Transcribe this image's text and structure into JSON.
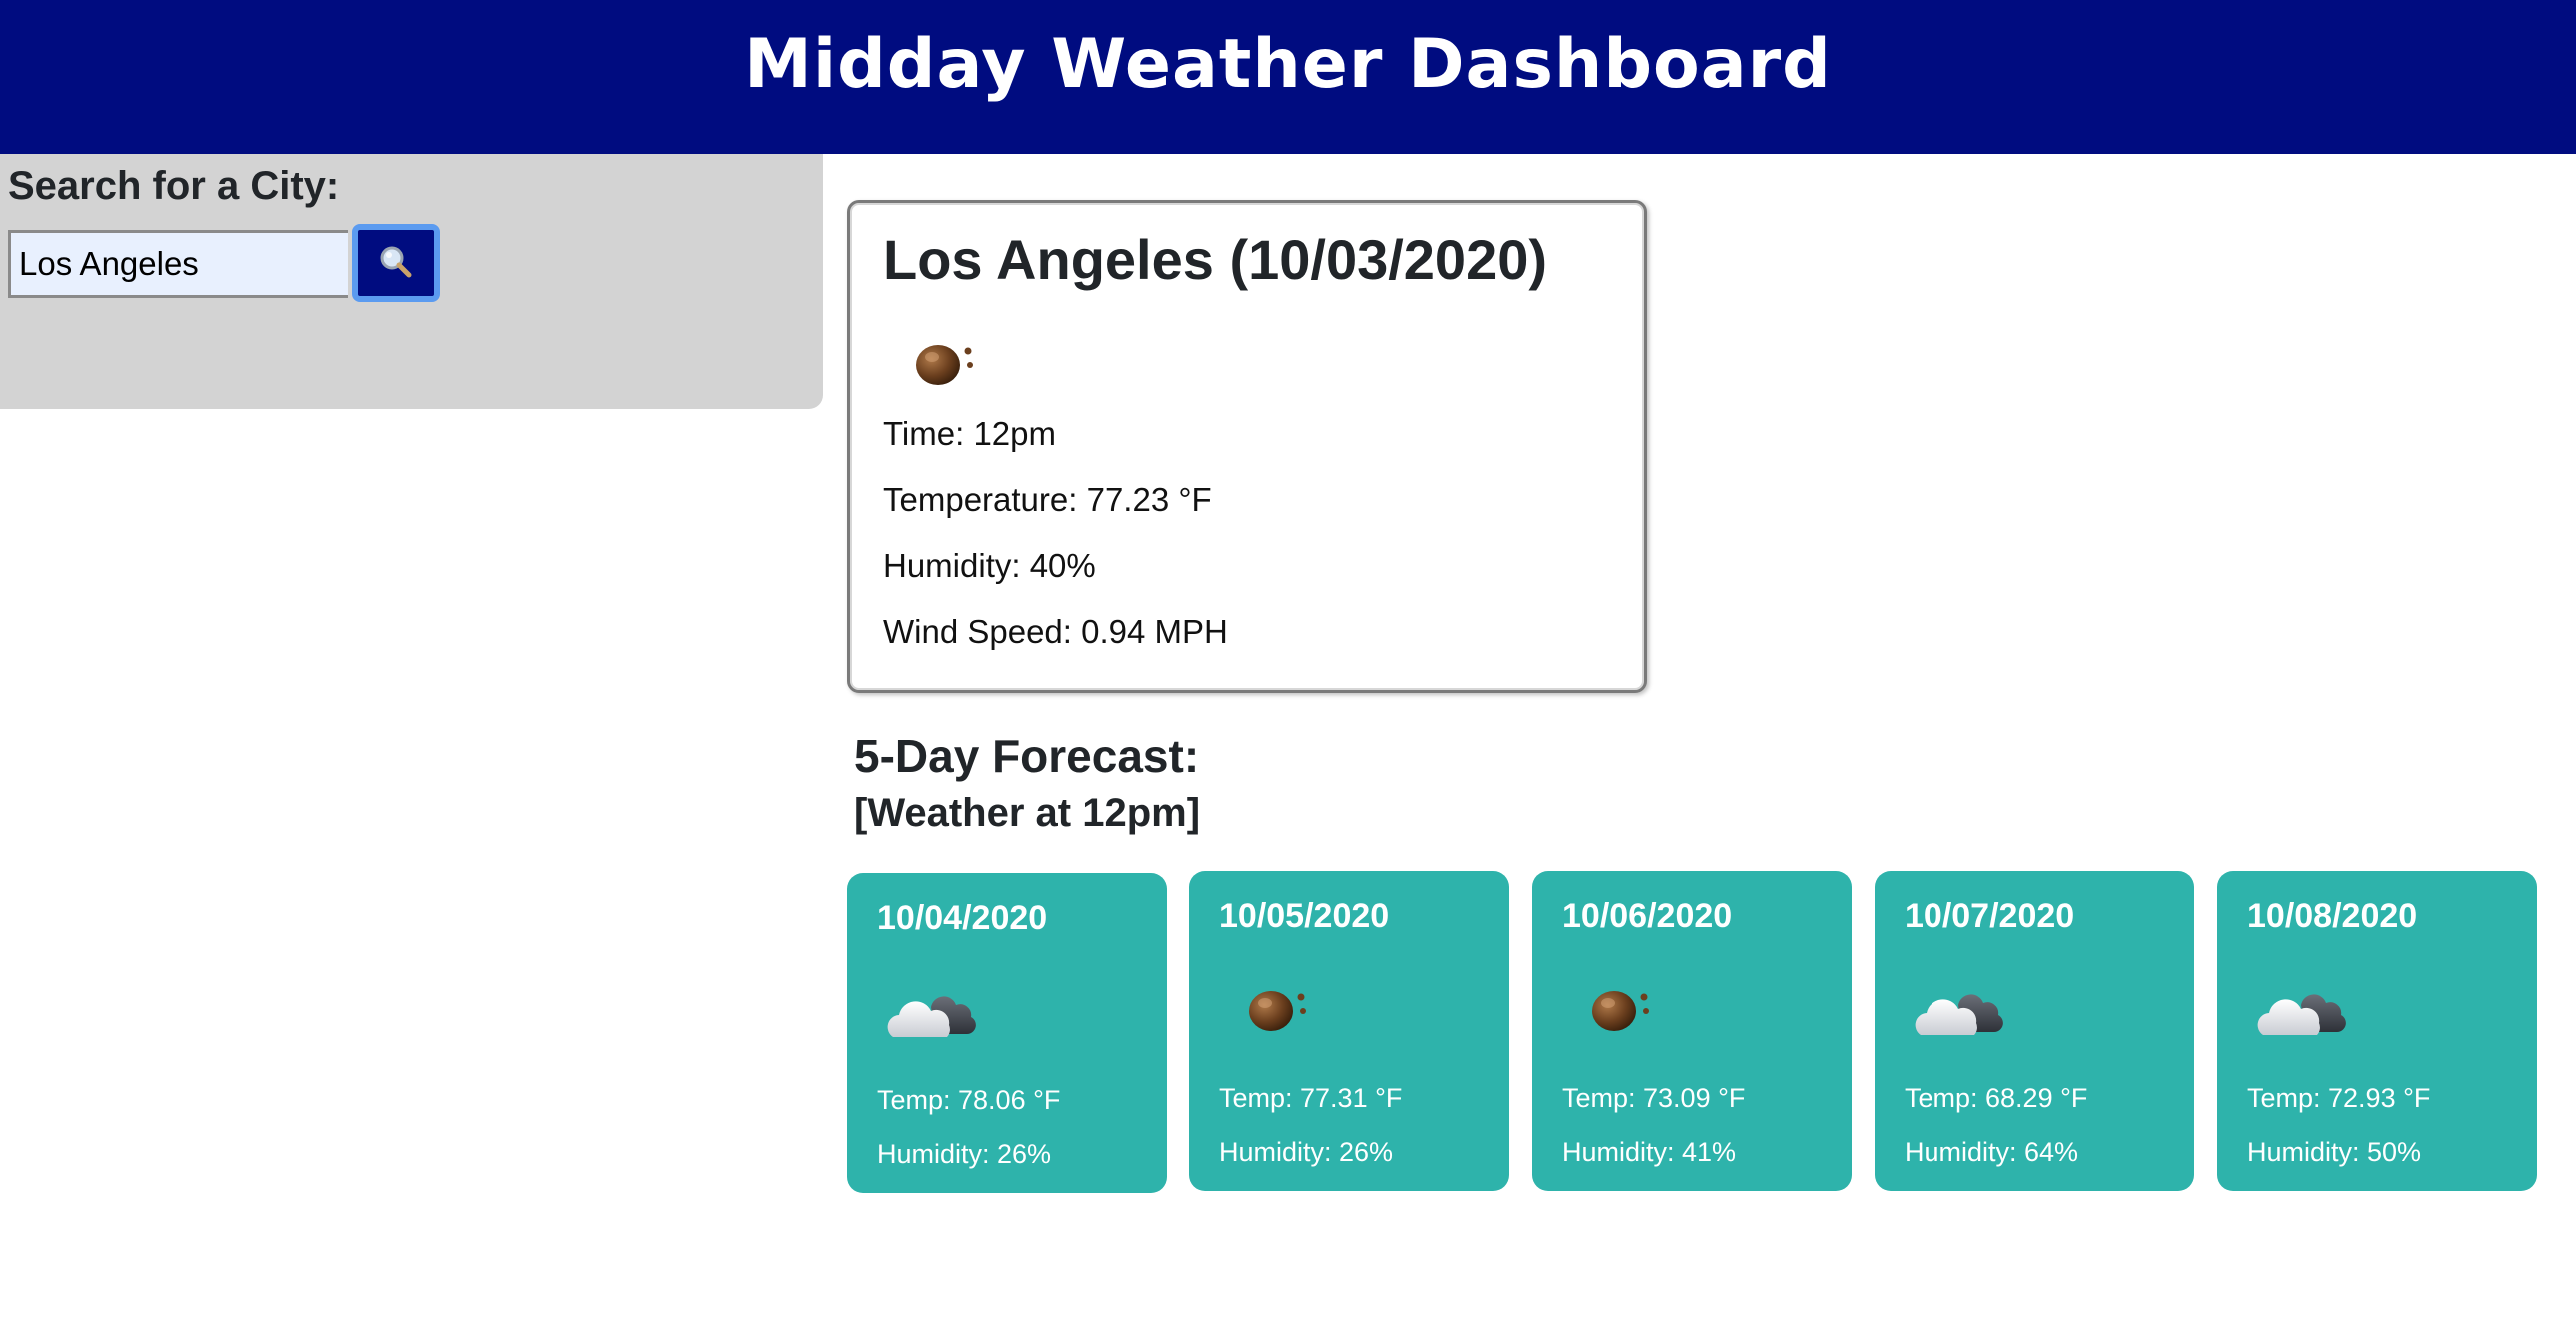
{
  "header": {
    "title": "Midday Weather Dashboard"
  },
  "search": {
    "label": "Search for a City:",
    "value": "Los Angeles",
    "button_icon": "magnifying-glass-icon"
  },
  "current": {
    "title": "Los Angeles (10/03/2020)",
    "icon": "haze-sun-icon",
    "time": "Time: 12pm",
    "temperature": "Temperature: 77.23 °F",
    "humidity": "Humidity: 40%",
    "wind": "Wind Speed: 0.94 MPH"
  },
  "forecast": {
    "heading": "5-Day Forecast:",
    "subheading": "[Weather at 12pm]",
    "days": [
      {
        "date": "10/04/2020",
        "icon": "cloud-icon",
        "temp": "Temp: 78.06 °F",
        "humidity": "Humidity: 26%"
      },
      {
        "date": "10/05/2020",
        "icon": "haze-sun-icon",
        "temp": "Temp: 77.31 °F",
        "humidity": "Humidity: 26%"
      },
      {
        "date": "10/06/2020",
        "icon": "haze-sun-icon",
        "temp": "Temp: 73.09 °F",
        "humidity": "Humidity: 41%"
      },
      {
        "date": "10/07/2020",
        "icon": "cloud-icon",
        "temp": "Temp: 68.29 °F",
        "humidity": "Humidity: 64%"
      },
      {
        "date": "10/08/2020",
        "icon": "cloud-icon",
        "temp": "Temp: 72.93 °F",
        "humidity": "Humidity: 50%"
      }
    ]
  },
  "colors": {
    "header_bg": "#000c80",
    "sidebar_bg": "#d3d3d3",
    "forecast_card_bg": "#2eb3ab",
    "search_button_border": "#5b9bf0"
  }
}
